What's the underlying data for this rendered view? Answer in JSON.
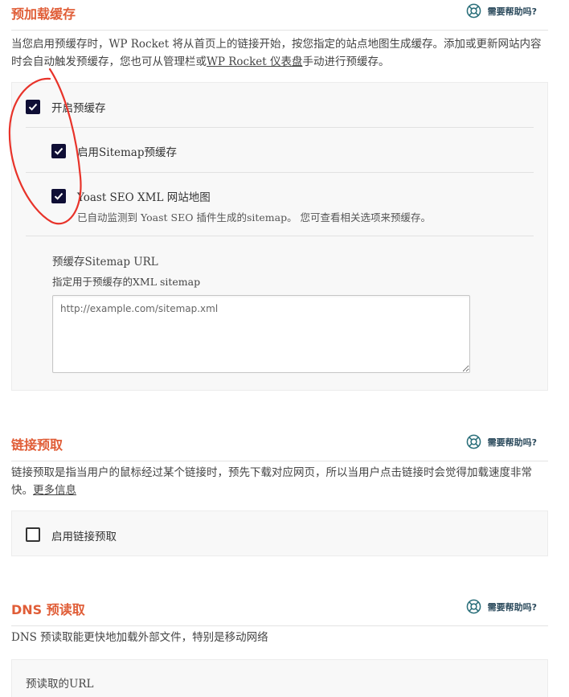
{
  "help_label": "需要帮助吗?",
  "preload": {
    "title": "预加载缓存",
    "desc_prefix": "当您启用预缓存时，WP Rocket 将从首页上的链接开始，按您指定的站点地图生成缓存。添加或更新网站内容时会自动触发预缓存，您也可从管理栏或",
    "desc_link": "WP Rocket 仪表盘",
    "desc_suffix": "手动进行预缓存。",
    "options": [
      {
        "label": "开启预缓存",
        "checked": true
      },
      {
        "label": "启用Sitemap预缓存",
        "checked": true
      },
      {
        "label": "Yoast SEO XML 网站地图",
        "sub": "已自动监测到 Yoast SEO 插件生成的sitemap。 您可查看相关选项来预缓存。",
        "checked": true
      }
    ],
    "sitemap_url": {
      "label": "预缓存Sitemap URL",
      "sub": "指定用于预缓存的XML sitemap",
      "placeholder": "http://example.com/sitemap.xml"
    }
  },
  "link_prefetch": {
    "title": "链接预取",
    "desc": "链接预取是指当用户的鼠标经过某个链接时，预先下载对应网页，所以当用户点击链接时会觉得加载速度非常快。",
    "more_link": "更多信息",
    "option": {
      "label": "启用链接预取",
      "checked": false
    }
  },
  "dns_prefetch": {
    "title": "DNS 预读取",
    "desc": "DNS 预读取能更快地加载外部文件，特别是移动网络",
    "field_label": "预读取的URL"
  },
  "colors": {
    "accent": "#e05d37",
    "checkbox": "#0f0e35",
    "annotation": "#e8332a"
  }
}
